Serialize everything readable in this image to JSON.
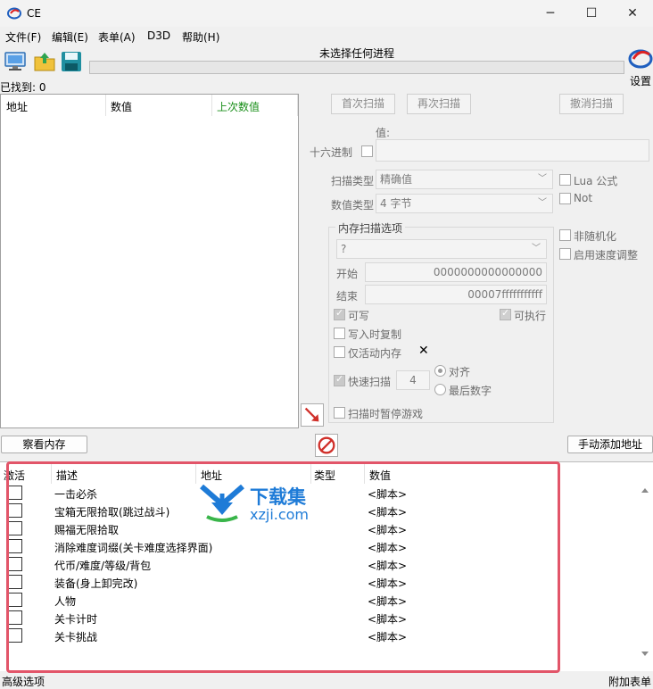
{
  "window": {
    "title": "CE",
    "minimize": "─",
    "maximize": "☐",
    "close": "✕"
  },
  "menu": [
    "文件(F)",
    "编辑(E)",
    "表单(A)",
    "D3D",
    "帮助(H)"
  ],
  "toolbar": {
    "process_title": "未选择任何进程",
    "settings_label": "设置"
  },
  "found": "已找到: 0",
  "result_list": {
    "columns": [
      "地址",
      "数值",
      "上次数值"
    ]
  },
  "scan": {
    "first_scan": "首次扫描",
    "next_scan": "再次扫描",
    "undo_scan": "撤消扫描",
    "value_label": "值:",
    "hex_label": "十六进制",
    "scan_type_label": "扫描类型",
    "scan_type_value": "精确值",
    "value_type_label": "数值类型",
    "value_type_value": "4 字节",
    "lua_label": "Lua 公式",
    "not_label": "Not",
    "no_random_label": "非随机化",
    "speedhack_label": "启用速度调整"
  },
  "memory": {
    "group_title": "内存扫描选项",
    "region_value": "?",
    "start_label": "开始",
    "start_value": "0000000000000000",
    "stop_label": "结束",
    "stop_value": "00007fffffffffff",
    "writable": "可写",
    "executable": "可执行",
    "copy_on_write": "写入时复制",
    "active_memory": "仅活动内存",
    "fast_scan": "快速扫描",
    "fast_scan_value": "4",
    "align": "对齐",
    "last_digits": "最后数字",
    "pause_game": "扫描时暂停游戏"
  },
  "buttons": {
    "view_memory": "察看内存",
    "add_address": "手动添加地址"
  },
  "address_list": {
    "columns": [
      "激活",
      "描述",
      "地址",
      "类型",
      "数值"
    ],
    "rows": [
      {
        "desc": "一击必杀",
        "value": "<脚本>"
      },
      {
        "desc": "宝箱无限拾取(跳过战斗)",
        "value": "<脚本>"
      },
      {
        "desc": "赐福无限拾取",
        "value": "<脚本>"
      },
      {
        "desc": "消除难度词缀(关卡难度选择界面)",
        "value": "<脚本>"
      },
      {
        "desc": "代币/难度/等级/背包",
        "value": "<脚本>"
      },
      {
        "desc": "装备(身上卸完改)",
        "value": "<脚本>"
      },
      {
        "desc": "人物",
        "value": "<脚本>"
      },
      {
        "desc": "关卡计时",
        "value": "<脚本>"
      },
      {
        "desc": "关卡挑战",
        "value": "<脚本>"
      }
    ]
  },
  "watermark": {
    "text_cn": "下载集",
    "text_url": "xzji.com"
  },
  "footer": {
    "advanced": "高级选项",
    "extra_table": "附加表单"
  },
  "colors": {
    "highlight": "#e25569",
    "last_value_header": "#1a8f1a",
    "watermark": "#1e7bd7"
  }
}
